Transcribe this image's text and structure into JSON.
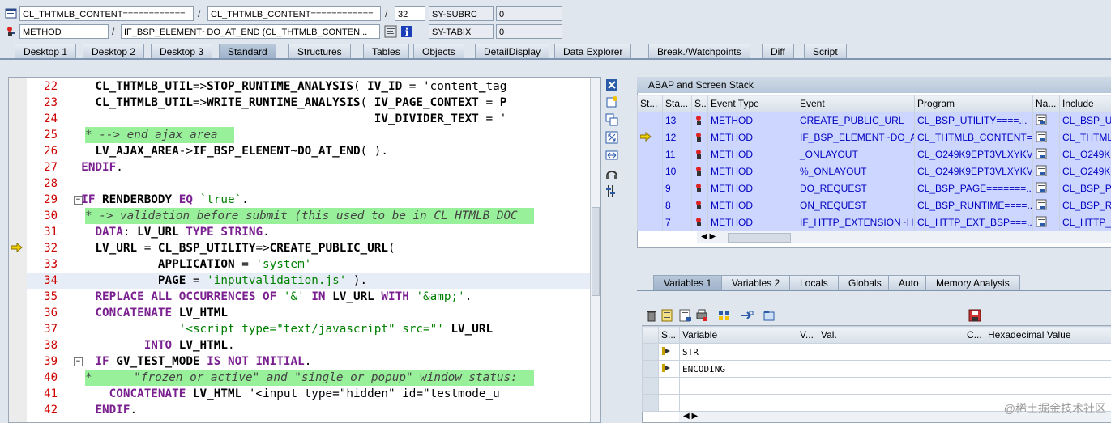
{
  "toolbar": {
    "row1": {
      "class_field": "CL_THTMLB_CONTENT============",
      "class_field2": "CL_THTMLB_CONTENT============",
      "line_no": "32",
      "sy_label": "SY-SUBRC",
      "sy_value": "0"
    },
    "row2": {
      "type_field": "METHOD",
      "event_field": "IF_BSP_ELEMENT~DO_AT_END (CL_THTMLB_CONTEN...",
      "sy_label": "SY-TABIX",
      "sy_value": "0"
    },
    "slash": "/"
  },
  "tabs": [
    "Desktop 1",
    "Desktop 2",
    "Desktop 3",
    "Standard",
    "Structures",
    "Tables",
    "Objects",
    "DetailDisplay",
    "Data Explorer",
    "Break./Watchpoints",
    "Diff",
    "Script"
  ],
  "active_tab": "Standard",
  "code_lines": [
    {
      "n": "22",
      "t": "    CL_THTMLB_UTIL=>STOP_RUNTIME_ANALYSIS( IV_ID = 'content_tag"
    },
    {
      "n": "23",
      "t": "    CL_THTMLB_UTIL=>WRITE_RUNTIME_ANALYSIS( IV_PAGE_CONTEXT = P"
    },
    {
      "n": "24",
      "t": "                                            IV_DIVIDER_TEXT = '"
    },
    {
      "n": "25",
      "t": "* --> end ajax area"
    },
    {
      "n": "26",
      "t": "    LV_AJAX_AREA->IF_BSP_ELEMENT~DO_AT_END( )."
    },
    {
      "n": "27",
      "t": "  ENDIF."
    },
    {
      "n": "28",
      "t": ""
    },
    {
      "n": "29",
      "t": "  IF RENDERBODY EQ `true`."
    },
    {
      "n": "30",
      "t": "* -> validation before submit (this used to be in CL_HTMLB_DOC"
    },
    {
      "n": "31",
      "t": "    DATA: LV_URL TYPE STRING."
    },
    {
      "n": "32",
      "t": "    LV_URL = CL_BSP_UTILITY=>CREATE_PUBLIC_URL("
    },
    {
      "n": "33",
      "t": "             APPLICATION = 'system'"
    },
    {
      "n": "34",
      "t": "             PAGE = 'inputvalidation.js' )."
    },
    {
      "n": "35",
      "t": "    REPLACE ALL OCCURRENCES OF '&' IN LV_URL WITH '&amp;'."
    },
    {
      "n": "36",
      "t": "    CONCATENATE LV_HTML"
    },
    {
      "n": "37",
      "t": "                '<script type=\"text/javascript\" src=\"' LV_URL"
    },
    {
      "n": "38",
      "t": "           INTO LV_HTML."
    },
    {
      "n": "39",
      "t": "    IF GV_TEST_MODE IS NOT INITIAL."
    },
    {
      "n": "40",
      "t": "*      \"frozen or active\" and \"single or popup\" window status:"
    },
    {
      "n": "41",
      "t": "      CONCATENATE LV_HTML '<input type=\"hidden\" id=\"testmode_u"
    },
    {
      "n": "42",
      "t": "    ENDIF."
    }
  ],
  "stack": {
    "title": "ABAP and Screen Stack",
    "headers": [
      "St...",
      "Sta...",
      "S...",
      "Event Type",
      "Event",
      "Program",
      "Na...",
      "Include"
    ],
    "rows": [
      {
        "level": "13",
        "type": "METHOD",
        "event": "CREATE_PUBLIC_URL",
        "program": "CL_BSP_UTILITY====...",
        "include": "CL_BSP_UT"
      },
      {
        "level": "12",
        "type": "METHOD",
        "event": "IF_BSP_ELEMENT~DO_A...",
        "program": "CL_THTMLB_CONTENT=...",
        "include": "CL_THTML"
      },
      {
        "level": "11",
        "type": "METHOD",
        "event": "_ONLAYOUT",
        "program": "CL_O249K9EPT3VLXYKV...",
        "include": "CL_O249K"
      },
      {
        "level": "10",
        "type": "METHOD",
        "event": "%_ONLAYOUT",
        "program": "CL_O249K9EPT3VLXYKV...",
        "include": "CL_O249K"
      },
      {
        "level": "9",
        "type": "METHOD",
        "event": "DO_REQUEST",
        "program": "CL_BSP_PAGE=======...",
        "include": "CL_BSP_PA"
      },
      {
        "level": "8",
        "type": "METHOD",
        "event": "ON_REQUEST",
        "program": "CL_BSP_RUNTIME====...",
        "include": "CL_BSP_RU"
      },
      {
        "level": "7",
        "type": "METHOD",
        "event": "IF_HTTP_EXTENSION~H...",
        "program": "CL_HTTP_EXT_BSP===...",
        "include": "CL_HTTP_"
      }
    ]
  },
  "var_tabs": [
    "Variables 1",
    "Variables 2",
    "Locals",
    "Globals",
    "Auto",
    "Memory Analysis"
  ],
  "vars": {
    "headers": [
      "S...",
      "Variable",
      "V...",
      "Val.",
      "C...",
      "Hexadecimal Value"
    ],
    "rows": [
      {
        "name": "STR"
      },
      {
        "name": "ENCODING"
      },
      {
        "name": ""
      },
      {
        "name": ""
      }
    ]
  },
  "watermark": "@稀土掘金技术社区"
}
